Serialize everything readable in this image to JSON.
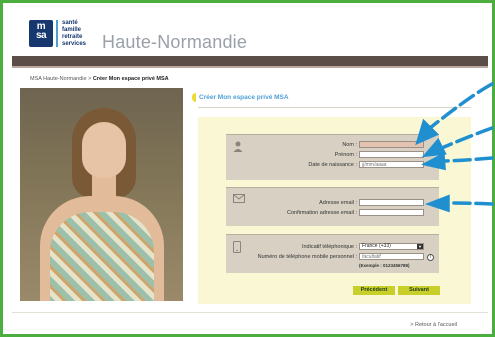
{
  "header": {
    "logo_text": "msa",
    "tagline": [
      "santé",
      "famille",
      "retraite",
      "services"
    ],
    "region": "Haute-Normandie"
  },
  "breadcrumb": {
    "home": "MSA Haute-Normandie",
    "separator": ">",
    "current": "Créer Mon espace privé MSA"
  },
  "section": {
    "title": "Créer Mon espace privé MSA"
  },
  "identity": {
    "nom_label": "Nom :",
    "prenom_label": "Prénom :",
    "dob_label": "Date de naissance :",
    "nom_value": "",
    "prenom_value": "",
    "dob_placeholder": "jj/mm/aaaa"
  },
  "email": {
    "email_label": "Adresse email :",
    "confirm_label": "Confirmation adresse email :",
    "email_value": "",
    "confirm_value": ""
  },
  "phone": {
    "indicatif_label": "Indicatif téléphonique :",
    "indicatif_value": "France (+33)",
    "mobile_label": "Numéro de téléphone mobile personnel :",
    "mobile_placeholder": "facultatif",
    "example": "(Exemple : 0123456789)"
  },
  "buttons": {
    "prev": "Précédent",
    "next": "Suivant"
  },
  "footer": {
    "back_link": "> Retour à l'accueil"
  },
  "colors": {
    "frame": "#4cae3f",
    "brand_blue": "#17386e",
    "accent_blue": "#4e9fd6",
    "band_brown": "#5b4e49",
    "form_bg": "#faf7d4",
    "block_bg": "#d7d0c3",
    "button": "#c9cf2a",
    "annotation_arrow": "#1f8fd0"
  },
  "icons": {
    "identity": "user-icon",
    "email": "envelope-icon",
    "phone": "mobile-phone-icon",
    "info": "info-icon",
    "select_arrow": "chevron-down-icon"
  }
}
